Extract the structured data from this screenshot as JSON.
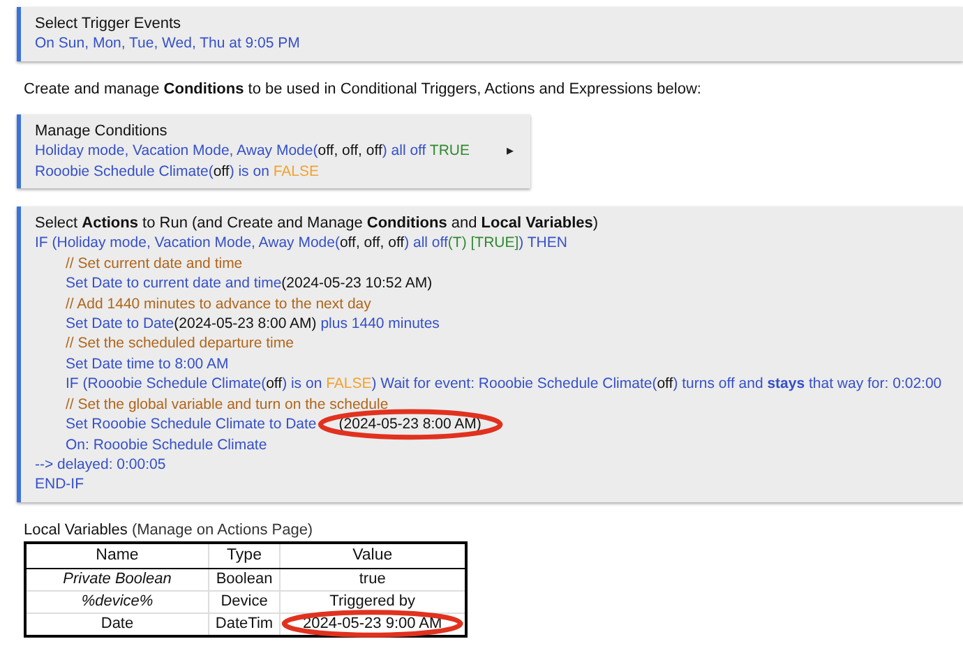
{
  "trigger_card": {
    "title": "Select Trigger Events",
    "lines": [
      {
        "segments": [
          {
            "text": "On Sun, Mon, Tue, Wed, Thu at 9:05 PM",
            "kind": "label"
          }
        ]
      }
    ]
  },
  "description": "Create and manage **Conditions** to be used in Conditional Triggers, Actions and Expressions below:",
  "conditions_card": {
    "title": "Manage Conditions",
    "expander": "▸",
    "lines": [
      {
        "segments": [
          {
            "text": "Holiday mode, Vacation Mode, Away Mode(",
            "kind": "label"
          },
          {
            "text": "off, off, off",
            "kind": "value"
          },
          {
            "text": ") all off ",
            "kind": "label"
          },
          {
            "text": "TRUE",
            "kind": "true"
          }
        ]
      },
      {
        "segments": [
          {
            "text": "Rooobie Schedule Climate(",
            "kind": "label"
          },
          {
            "text": "off",
            "kind": "value"
          },
          {
            "text": ") is on ",
            "kind": "label"
          },
          {
            "text": "FALSE",
            "kind": "false"
          }
        ]
      }
    ]
  },
  "actions_card": {
    "title": "Select **Actions** to Run (and Create and Manage **Conditions** and **Local Variables**)",
    "lines": [
      {
        "segments": [
          {
            "text": "IF (Holiday mode, Vacation Mode, Away Mode(",
            "kind": "label"
          },
          {
            "text": "off, off, off",
            "kind": "value"
          },
          {
            "text": ") all off",
            "kind": "label"
          },
          {
            "text": "(T) [TRUE]",
            "kind": "true"
          },
          {
            "text": ") THEN",
            "kind": "label"
          }
        ],
        "children": [
          {
            "segments": [
              {
                "text": "// Set current date and time",
                "kind": "comment"
              }
            ]
          },
          {
            "segments": [
              {
                "text": "Set Date to current date and time",
                "kind": "label"
              },
              {
                "text": "(2024-05-23 10:52 AM)",
                "kind": "value"
              }
            ]
          },
          {
            "segments": [
              {
                "text": "// Add 1440 minutes to advance to the next day",
                "kind": "comment"
              }
            ]
          },
          {
            "segments": [
              {
                "text": "Set Date to Date",
                "kind": "label"
              },
              {
                "text": "(2024-05-23 8:00 AM)",
                "kind": "value"
              },
              {
                "text": " plus 1440 minutes",
                "kind": "label"
              }
            ]
          },
          {
            "segments": [
              {
                "text": "// Set the scheduled departure time",
                "kind": "comment"
              }
            ]
          },
          {
            "segments": [
              {
                "text": "Set Date time to 8:00 AM",
                "kind": "label"
              }
            ]
          },
          {
            "segments": [
              {
                "text": "IF (Rooobie Schedule Climate(",
                "kind": "label"
              },
              {
                "text": "off",
                "kind": "value"
              },
              {
                "text": ") is on ",
                "kind": "label"
              },
              {
                "text": "FALSE",
                "kind": "false"
              },
              {
                "text": ") Wait for event: Rooobie Schedule Climate(",
                "kind": "label"
              },
              {
                "text": "off",
                "kind": "value"
              },
              {
                "text": ") turns off and **stays** that way for: 0:02:00",
                "kind": "label"
              }
            ]
          },
          {
            "segments": [
              {
                "text": "// Set the global variable and turn on the schedule",
                "kind": "comment"
              }
            ]
          },
          {
            "segments": [
              {
                "text": "Set Rooobie Schedule Climate to Date",
                "kind": "label"
              },
              {
                "text": "(2024-05-23 8:00 AM)",
                "kind": "value",
                "circled": true
              }
            ]
          },
          {
            "segments": [
              {
                "text": "On: Rooobie Schedule Climate",
                "kind": "label"
              }
            ]
          }
        ]
      },
      {
        "segments": [
          {
            "text": "--> delayed: 0:00:05",
            "kind": "label"
          }
        ]
      },
      {
        "segments": [
          {
            "text": "END-IF",
            "kind": "label"
          }
        ]
      }
    ]
  },
  "local_variables": {
    "title": "Local Variables",
    "subtitle": "(Manage on Actions Page)",
    "columns": [
      "Name",
      "Type",
      "Value"
    ],
    "rows": [
      {
        "name": "Private Boolean",
        "name_italic": true,
        "type": "Boolean",
        "value": "true",
        "value_circled": false
      },
      {
        "name": "%device%",
        "name_italic": true,
        "type": "Device",
        "value": "Triggered by",
        "value_circled": false
      },
      {
        "name": "Date",
        "name_italic": false,
        "type": "DateTim",
        "value": "2024-05-23 9:00 AM",
        "value_circled": true
      }
    ]
  }
}
